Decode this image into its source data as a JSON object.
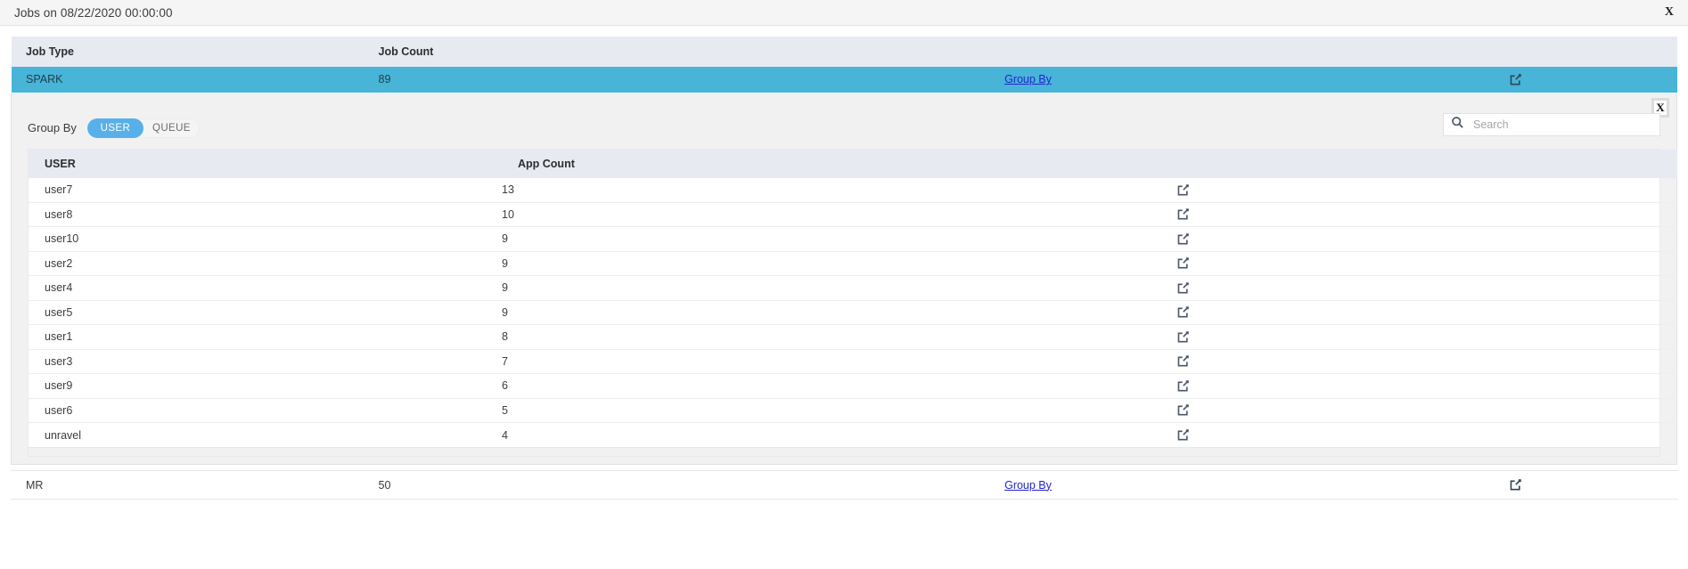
{
  "window": {
    "title": "Jobs on 08/22/2020 00:00:00",
    "close_label": "X"
  },
  "outer_table": {
    "columns": [
      "Job Type",
      "Job Count",
      "",
      ""
    ],
    "headers": {
      "job_type": "Job Type",
      "job_count": "Job Count"
    },
    "rows": [
      {
        "job_type": "SPARK",
        "job_count": "89",
        "group_by_link": "Group By",
        "open_icon": "external-link-icon",
        "selected": true
      },
      {
        "job_type": "MR",
        "job_count": "50",
        "group_by_link": "Group By",
        "open_icon": "external-link-icon",
        "selected": false
      }
    ]
  },
  "inner_panel": {
    "close_label": "X",
    "group_by_label": "Group By",
    "toggle": {
      "options": [
        "USER",
        "QUEUE"
      ],
      "selected": "USER"
    },
    "search": {
      "placeholder": "Search",
      "value": "",
      "icon": "search-icon"
    },
    "table": {
      "headers": {
        "user": "USER",
        "app_count": "App Count"
      },
      "rows": [
        {
          "user": "user7",
          "app_count": "13",
          "open_icon": "external-link-icon"
        },
        {
          "user": "user8",
          "app_count": "10",
          "open_icon": "external-link-icon"
        },
        {
          "user": "user10",
          "app_count": "9",
          "open_icon": "external-link-icon"
        },
        {
          "user": "user2",
          "app_count": "9",
          "open_icon": "external-link-icon"
        },
        {
          "user": "user4",
          "app_count": "9",
          "open_icon": "external-link-icon"
        },
        {
          "user": "user5",
          "app_count": "9",
          "open_icon": "external-link-icon"
        },
        {
          "user": "user1",
          "app_count": "8",
          "open_icon": "external-link-icon"
        },
        {
          "user": "user3",
          "app_count": "7",
          "open_icon": "external-link-icon"
        },
        {
          "user": "user9",
          "app_count": "6",
          "open_icon": "external-link-icon"
        },
        {
          "user": "user6",
          "app_count": "5",
          "open_icon": "external-link-icon"
        },
        {
          "user": "unravel",
          "app_count": "4",
          "open_icon": "external-link-icon"
        }
      ]
    }
  },
  "colors": {
    "selected_row": "#47b4d8",
    "table_header": "#e8eaf2",
    "toggle_active": "#58b0ea",
    "link": "#2424cf",
    "icon": "#4a5568",
    "panel_bg": "#f1f1f1",
    "titlebar_bg": "#f5f5f5"
  }
}
